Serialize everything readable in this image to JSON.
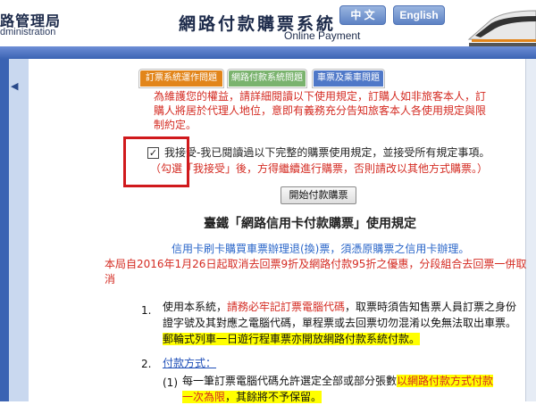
{
  "header": {
    "logo_text": "路管理局",
    "logo_sub": "dministration",
    "title_zh": "網路付款購票系統",
    "title_en": "Online Payment",
    "lang_zh": "中 文",
    "lang_en": "English"
  },
  "tabs": [
    {
      "label": "訂票系統運作問題"
    },
    {
      "label": "網路付款系統問題"
    },
    {
      "label": "車票及乘車問題"
    }
  ],
  "notice": "為維護您的權益，請詳細閱讀以下使用規定，訂購人如非旅客本人，訂購人將居於代理人地位，意即有義務充分告知旅客本人各使用規定與限制約定。",
  "accept": {
    "label": "我接受-我已閱讀過以下完整的購票使用規定，並接受所有規定事項。",
    "hint": "（勾選「我接受」後，方得繼續進行購票，否則請改以其他方式購票。）",
    "checked": true
  },
  "start_button": "開始付款購票",
  "rules": {
    "title": "臺鐵「網路信用卡付款購票」使用規定",
    "blue_line": "信用卡刷卡購買車票辦理退(換)票，須憑原購票之信用卡辦理。",
    "red_line": "本局自2016年1月26日起取消去回票9折及網路付款95折之優惠，分段組合去回票一併取消",
    "item1": {
      "num": "1.",
      "part1": "使用本系統，",
      "part2": "請務必牢記訂票電腦代碼",
      "part3": "，取票時須告知售票人員訂票之身份證字號及其對應之電腦代碼，單程票或去回票切勿混淆以免無法取出車票。",
      "part4": "郵輪式列車一日遊行程車票亦開放網路付款系統付款。"
    },
    "item2": {
      "num": "2.",
      "label": "付款方式："
    },
    "item3": {
      "num": "(1)",
      "part1": "每一筆訂票電腦代碼允許選定全部或部分張數",
      "part2": "以網路付款方式付款一次為限",
      "part3": "，其餘將不予保留。"
    }
  }
}
